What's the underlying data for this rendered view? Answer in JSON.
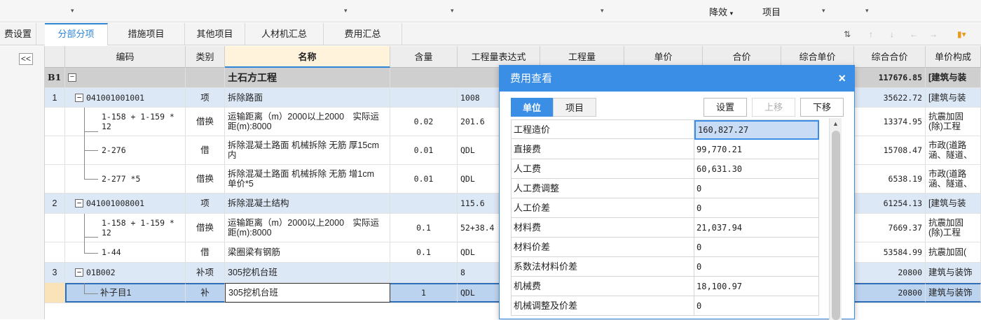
{
  "toolbar": {
    "items": [
      {
        "label": "降效",
        "arrow": "▾"
      },
      {
        "label": "项目",
        "arrow": ""
      }
    ]
  },
  "tabs": [
    {
      "label": "费设置",
      "active": false
    },
    {
      "label": "分部分项",
      "active": true
    },
    {
      "label": "措施项目",
      "active": false
    },
    {
      "label": "其他项目",
      "active": false
    },
    {
      "label": "人材机汇总",
      "active": false
    },
    {
      "label": "费用汇总",
      "active": false
    }
  ],
  "nav": {
    "collapse": "<<"
  },
  "grid": {
    "headers": [
      "编码",
      "类别",
      "名称",
      "含量",
      "工程量表达式",
      "工程量",
      "单价",
      "合价",
      "综合单价",
      "综合合价",
      "单价构成"
    ],
    "rows": [
      {
        "idx": "B1",
        "code": "",
        "type": "",
        "name": "土石方工程",
        "qty": "",
        "expr": "",
        "total": "117676.85",
        "comp": "[建筑与装"
      },
      {
        "idx": "1",
        "code": "041001001001",
        "type": "项",
        "name": "拆除路面",
        "qty": "",
        "expr": "1008",
        "total": "35622.72",
        "comp": "[建筑与装"
      },
      {
        "idx": "",
        "code": "1-158 + 1-159 * 12",
        "type": "借换",
        "name": "运输距离（m）2000以上2000　实际运距(m):8000",
        "qty": "0.02",
        "expr": "201.6",
        "total": "13374.95",
        "comp": "抗震加固(除)工程"
      },
      {
        "idx": "",
        "code": "2-276",
        "type": "借",
        "name": "拆除混凝土路面 机械拆除 无筋 厚15cm内",
        "qty": "0.01",
        "expr": "QDL",
        "total": "15708.47",
        "comp": "市政(道路涵、隧道、"
      },
      {
        "idx": "",
        "code": "2-277 *5",
        "type": "借换",
        "name": "拆除混凝土路面 机械拆除 无筋 增1cm　单价*5",
        "qty": "0.01",
        "expr": "QDL",
        "total": "6538.19",
        "comp": "市政(道路涵、隧道、"
      },
      {
        "idx": "2",
        "code": "041001008001",
        "type": "项",
        "name": "拆除混凝土结构",
        "qty": "",
        "expr": "115.6",
        "total": "61254.13",
        "comp": "[建筑与装"
      },
      {
        "idx": "",
        "code": "1-158 + 1-159 * 12",
        "type": "借换",
        "name": "运输距离（m）2000以上2000　实际运距(m):8000",
        "qty": "0.1",
        "expr": "52+38.4",
        "total": "7669.37",
        "comp": "抗震加固(除)工程"
      },
      {
        "idx": "",
        "code": "1-44",
        "type": "借",
        "name": "梁圈梁有钢筋",
        "qty": "0.1",
        "expr": "QDL",
        "total": "53584.99",
        "comp": "抗震加固("
      },
      {
        "idx": "3",
        "code": "01B002",
        "type": "补项",
        "name": "305挖机台班",
        "qty": "",
        "expr": "8",
        "total": "20800",
        "comp": "建筑与装饰"
      },
      {
        "idx": "",
        "code": "补子目1",
        "type": "补",
        "name": "305挖机台班",
        "qty": "1",
        "expr": "QDL",
        "total": "20800",
        "comp": "建筑与装饰"
      }
    ]
  },
  "dialog": {
    "title": "费用查看",
    "close": "×",
    "tabs": [
      "单位",
      "项目"
    ],
    "buttons": {
      "settings": "设置",
      "up": "上移",
      "down": "下移"
    },
    "rows": [
      {
        "name": "工程造价",
        "value": "160,827.27"
      },
      {
        "name": "直接费",
        "value": "99,770.21"
      },
      {
        "name": "人工费",
        "value": "60,631.30"
      },
      {
        "name": "人工费调整",
        "value": "0"
      },
      {
        "name": "人工价差",
        "value": "0"
      },
      {
        "name": "材料费",
        "value": "21,037.94"
      },
      {
        "name": "材料价差",
        "value": "0"
      },
      {
        "name": "系数法材料价差",
        "value": "0"
      },
      {
        "name": "机械费",
        "value": "18,100.97"
      },
      {
        "name": "机械调整及价差",
        "value": "0"
      }
    ]
  }
}
